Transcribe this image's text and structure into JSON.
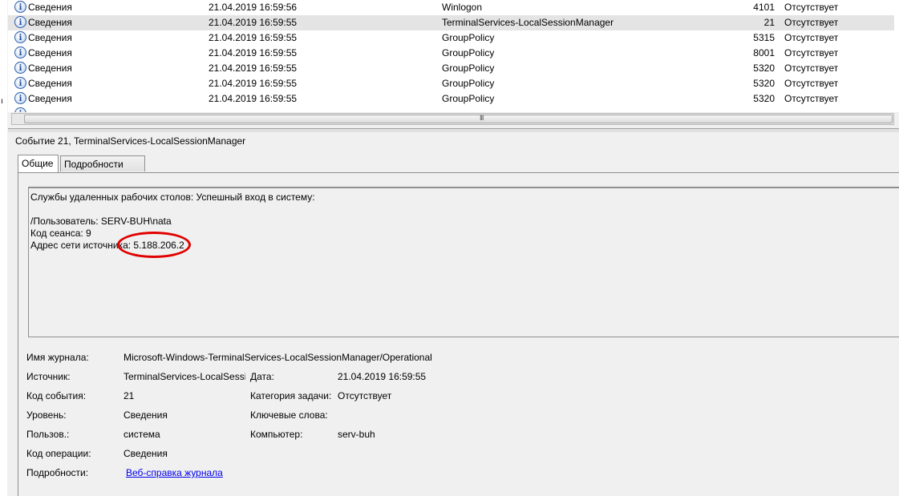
{
  "event_list": {
    "rows": [
      {
        "level": "Сведения",
        "date": "21.04.2019 16:59:56",
        "source": "Winlogon",
        "event_id": "4101",
        "task": "Отсутствует"
      },
      {
        "level": "Сведения",
        "date": "21.04.2019 16:59:55",
        "source": "TerminalServices-LocalSessionManager",
        "event_id": "21",
        "task": "Отсутствует"
      },
      {
        "level": "Сведения",
        "date": "21.04.2019 16:59:55",
        "source": "GroupPolicy",
        "event_id": "5315",
        "task": "Отсутствует"
      },
      {
        "level": "Сведения",
        "date": "21.04.2019 16:59:55",
        "source": "GroupPolicy",
        "event_id": "8001",
        "task": "Отсутствует"
      },
      {
        "level": "Сведения",
        "date": "21.04.2019 16:59:55",
        "source": "GroupPolicy",
        "event_id": "5320",
        "task": "Отсутствует"
      },
      {
        "level": "Сведения",
        "date": "21.04.2019 16:59:55",
        "source": "GroupPolicy",
        "event_id": "5320",
        "task": "Отсутствует"
      },
      {
        "level": "Сведения",
        "date": "21.04.2019 16:59:55",
        "source": "GroupPolicy",
        "event_id": "5320",
        "task": "Отсутствует"
      }
    ],
    "selected_index": 1,
    "icon": "info-icon"
  },
  "scrollbar": {
    "grip": "III"
  },
  "left_strip_mark": "ı",
  "detail": {
    "title": "Событие 21, TerminalServices-LocalSessionManager",
    "tabs": {
      "general": "Общие",
      "details": "Подробности"
    },
    "message": {
      "line1": "Службы удаленных рабочих столов: Успешный вход в систему:",
      "user": "/Пользователь: SERV-BUH\\nata",
      "session": "Код сеанса: 9",
      "address": "Адрес сети источника: 5.188.206.2"
    },
    "highlight_color": "#e00000",
    "props": {
      "log_name_label": "Имя журнала:",
      "log_name_value": "Microsoft-Windows-TerminalServices-LocalSessionManager/Operational",
      "source_label": "Источник:",
      "source_value": "TerminalServices-LocalSessi",
      "date_label": "Дата:",
      "date_value": "21.04.2019 16:59:55",
      "event_id_label": "Код события:",
      "event_id_value": "21",
      "task_label": "Категория задачи:",
      "task_value": "Отсутствует",
      "level_label": "Уровень:",
      "level_value": "Сведения",
      "keywords_label": "Ключевые слова:",
      "keywords_value": "",
      "user_label": "Пользов.:",
      "user_value": "система",
      "computer_label": "Компьютер:",
      "computer_value": "serv-buh",
      "opcode_label": "Код операции:",
      "opcode_value": "Сведения",
      "more_label": "Подробности:",
      "more_link": "Веб-справка журнала"
    }
  }
}
